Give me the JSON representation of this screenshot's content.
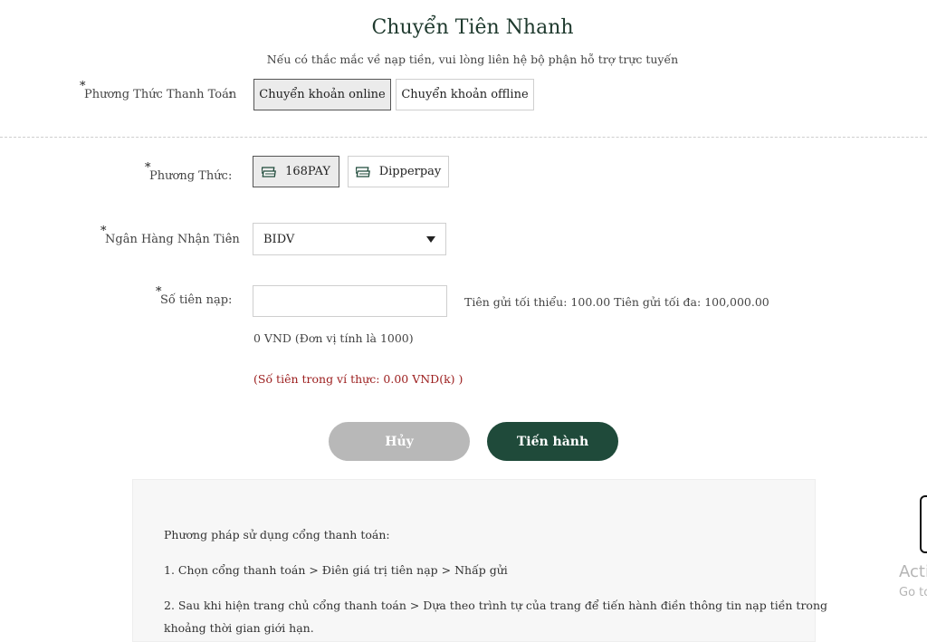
{
  "header": {
    "title": "Chuyển Tiên Nhanh",
    "subtitle": "Nếu có thắc mắc về nạp tiền, vui lòng liên hệ bộ phận hỗ trợ trực tuyến"
  },
  "form": {
    "required_mark": "*",
    "colon": ":",
    "payment_method": {
      "label": "Phương Thức Thanh Toán",
      "options": [
        "Chuyển khoản online",
        "Chuyển khoản offline"
      ],
      "selected": "Chuyển khoản online"
    },
    "method": {
      "label": "Phương Thức",
      "options": [
        "168PAY",
        "Dipperpay"
      ],
      "selected": "168PAY",
      "icon": "card-stack-icon"
    },
    "bank": {
      "label": "Ngân Hàng Nhận Tiên",
      "value": "BIDV"
    },
    "amount": {
      "label": "Số tiên nạp",
      "value": "",
      "limits": "Tiên gửi tối thiểu: 100.00 Tiên gửi tối đa: 100,000.00",
      "converted": "0 VND (Đơn vị tính là 1000)",
      "wallet": "(Số tiên trong ví thực: 0.00 VND(k) )"
    }
  },
  "actions": {
    "cancel": "Hủy",
    "proceed": "Tiến hành"
  },
  "guide": {
    "heading": "Phương pháp sử dụng cổng thanh toán:",
    "step1": "1. Chọn cổng thanh toán > Điên giá trị tiên nạp > Nhấp gửi",
    "step2_line1": "2. Sau khi hiện trang chủ cổng thanh toán > Dựa theo trình tự của trang để tiến hành điền thông tin nạp tiền trong",
    "step2_line2": "khoảng thời gian giới hạn."
  },
  "overlay": {
    "activate_line1": "Acti",
    "activate_line2": "Go to"
  },
  "colors": {
    "primary": "#1f4a3a",
    "cancel": "#b8b8b8",
    "warning": "#9b1c1c",
    "title": "#1f3a2e"
  }
}
